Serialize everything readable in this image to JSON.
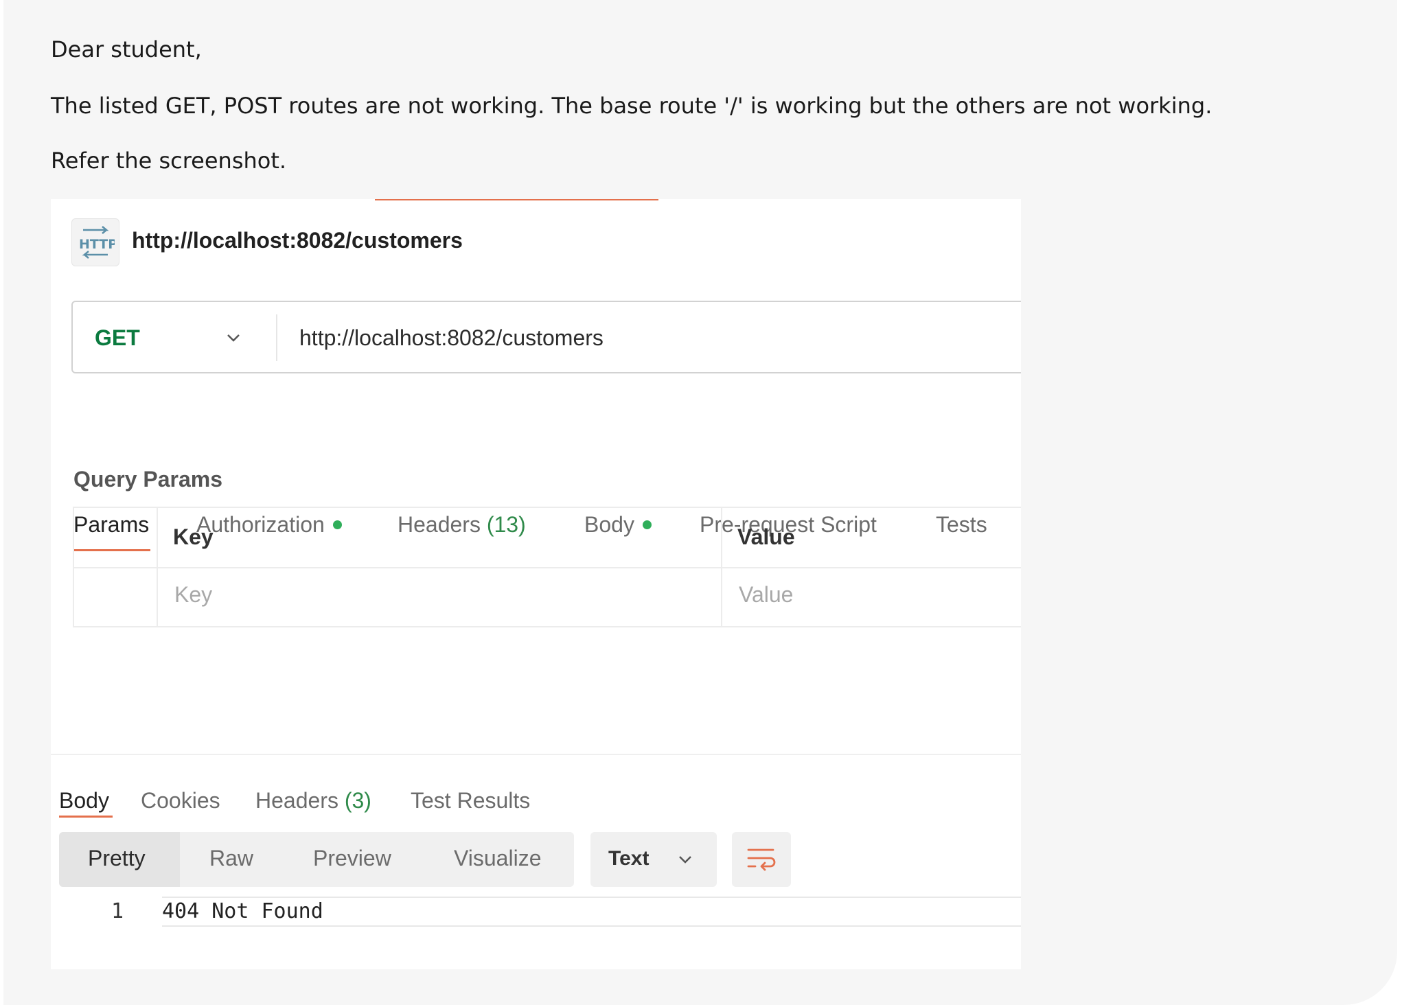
{
  "message": {
    "greeting": "Dear student,",
    "body": "The listed GET, POST routes are not working. The base route '/' is working but the others are not working.",
    "refer": "Refer the screenshot."
  },
  "request": {
    "icon": "http-icon",
    "title": "http://localhost:8082/customers",
    "method": "GET",
    "url": "http://localhost:8082/customers"
  },
  "request_tabs": {
    "params": "Params",
    "authorization": "Authorization",
    "headers": "Headers",
    "headers_count": "(13)",
    "body": "Body",
    "prerequest": "Pre-request Script",
    "tests": "Tests"
  },
  "query_params": {
    "label": "Query Params",
    "key_header": "Key",
    "value_header": "Value",
    "key_placeholder": "Key",
    "value_placeholder": "Value"
  },
  "response_tabs": {
    "body": "Body",
    "cookies": "Cookies",
    "headers": "Headers",
    "headers_count": "(3)",
    "test_results": "Test Results"
  },
  "view_modes": {
    "pretty": "Pretty",
    "raw": "Raw",
    "preview": "Preview",
    "visualize": "Visualize"
  },
  "format": {
    "selected": "Text"
  },
  "response": {
    "lines": [
      {
        "number": "1",
        "text": "404 Not Found"
      }
    ]
  },
  "colors": {
    "accent": "#e4704c",
    "method_get": "#0b7a3f",
    "status_dot": "#2fae5a",
    "count": "#2f8a4a"
  }
}
